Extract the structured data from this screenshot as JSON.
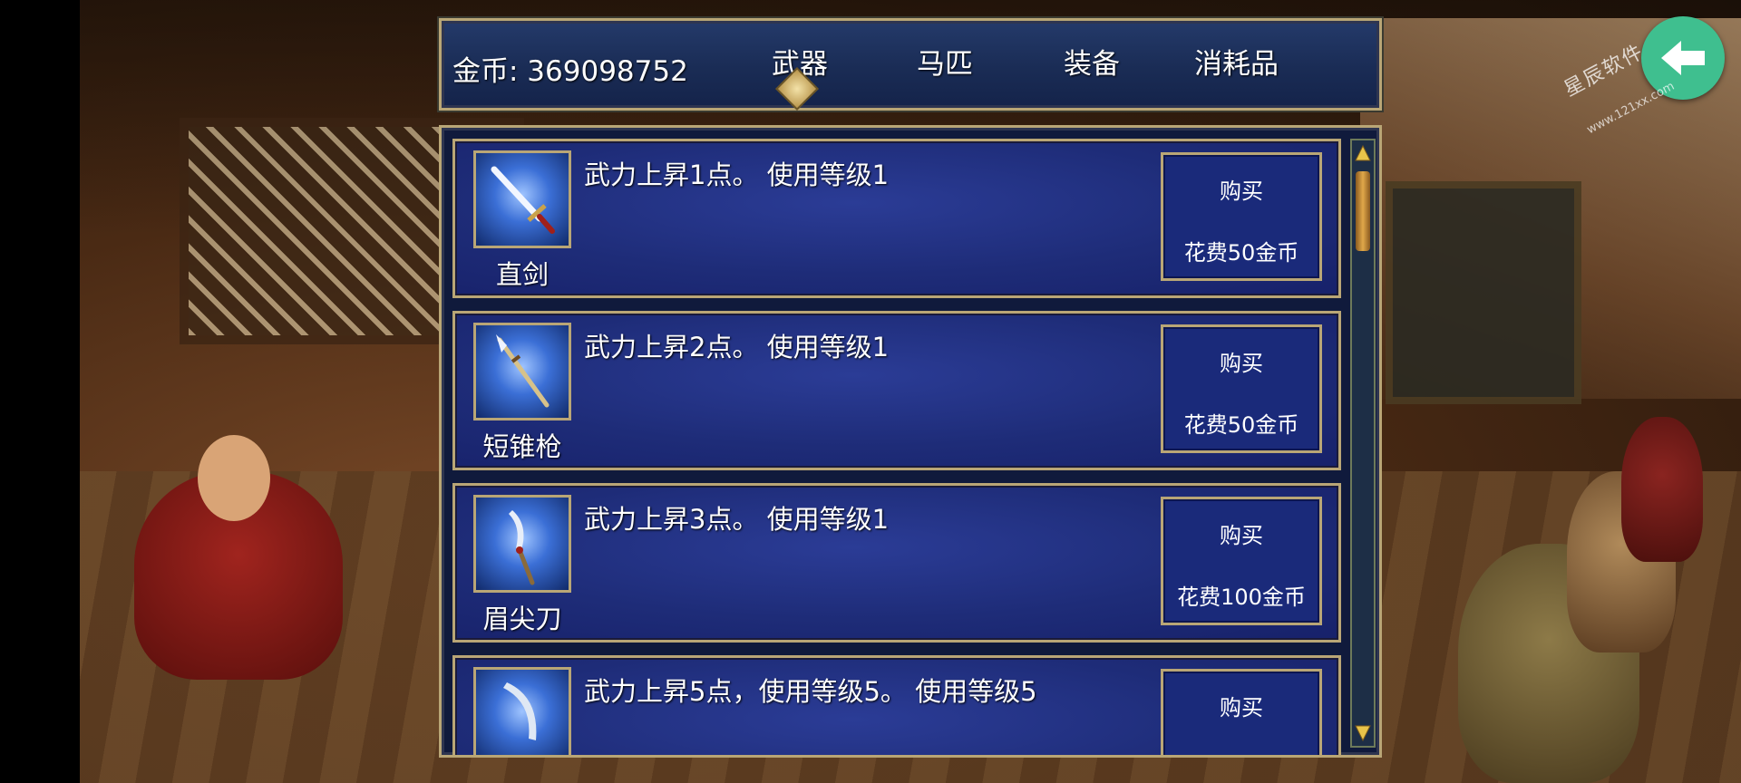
{
  "header": {
    "gold_text": "金币: 369098752",
    "tabs": [
      {
        "label": "武器",
        "active": true
      },
      {
        "label": "马匹",
        "active": false
      },
      {
        "label": "装备",
        "active": false
      },
      {
        "label": "消耗品",
        "active": false
      }
    ]
  },
  "back_button": {
    "icon": "arrow-left-icon"
  },
  "watermark": {
    "text": "星辰软件",
    "url": "www.121xx.com"
  },
  "items": [
    {
      "name": "直剑",
      "description": "武力上昇1点。 使用等级1",
      "buy_label": "购买",
      "cost_text": "花费50金币",
      "icon": "straight-sword-icon"
    },
    {
      "name": "短锥枪",
      "description": "武力上昇2点。 使用等级1",
      "buy_label": "购买",
      "cost_text": "花费50金币",
      "icon": "short-spear-icon"
    },
    {
      "name": "眉尖刀",
      "description": "武力上昇3点。 使用等级1",
      "buy_label": "购买",
      "cost_text": "花费100金币",
      "icon": "glaive-icon"
    },
    {
      "name": "",
      "description": "武力上昇5点，使用等级5。 使用等级5",
      "buy_label": "购买",
      "cost_text": "",
      "icon": "curved-blade-icon"
    }
  ],
  "colors": {
    "panel_border": "#b9a676",
    "panel_bg": "#1e2c78",
    "back_button": "#3fbf8f"
  }
}
